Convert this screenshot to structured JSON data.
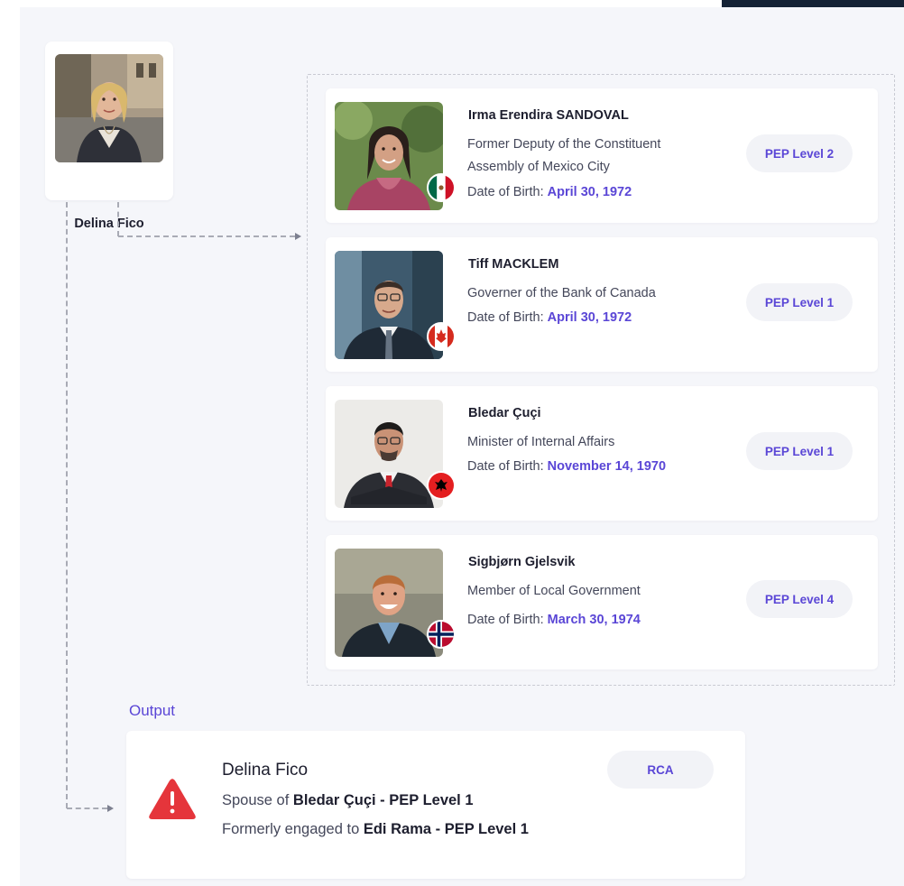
{
  "subject": {
    "name": "Delina Fico",
    "avatar_icon": "person-photo"
  },
  "matches": [
    {
      "name": "Irma Erendira SANDOVAL",
      "role_line1": "Former Deputy of the Constituent",
      "role_line2": "Assembly of Mexico City",
      "dob_label": "Date of Birth:",
      "dob": "April 30, 1972",
      "pep_level": "PEP Level 2",
      "flag": "mexico-flag-icon"
    },
    {
      "name": "Tiff MACKLEM",
      "role_line1": "Governer of the Bank of Canada",
      "dob_label": "Date of Birth:",
      "dob": "April 30, 1972",
      "pep_level": "PEP Level 1",
      "flag": "canada-flag-icon"
    },
    {
      "name": "Bledar Çuçi",
      "role_line1": "Minister of Internal Affairs",
      "dob_label": "Date of Birth:",
      "dob": "November 14, 1970",
      "pep_level": "PEP Level 1",
      "flag": "albania-flag-icon"
    },
    {
      "name": "Sigbjørn Gjelsvik",
      "role_line1": "Member of Local Government",
      "dob_label": "Date of Birth:",
      "dob": "March 30, 1974",
      "pep_level": "PEP Level 4",
      "flag": "norway-flag-icon"
    }
  ],
  "output": {
    "label": "Output",
    "name": "Delina Fico",
    "line1_prefix": "Spouse of",
    "line1_bold": "Bledar Çuçi - PEP Level 1",
    "line2_prefix": "Formerly engaged to",
    "line2_bold": "Edi Rama - PEP Level 1",
    "badge": "RCA",
    "icon": "warning-triangle-icon"
  },
  "colors": {
    "accent": "#5a46d6",
    "warning": "#e5353b",
    "background": "#f5f6fa",
    "badge_bg": "#f2f3f7"
  }
}
